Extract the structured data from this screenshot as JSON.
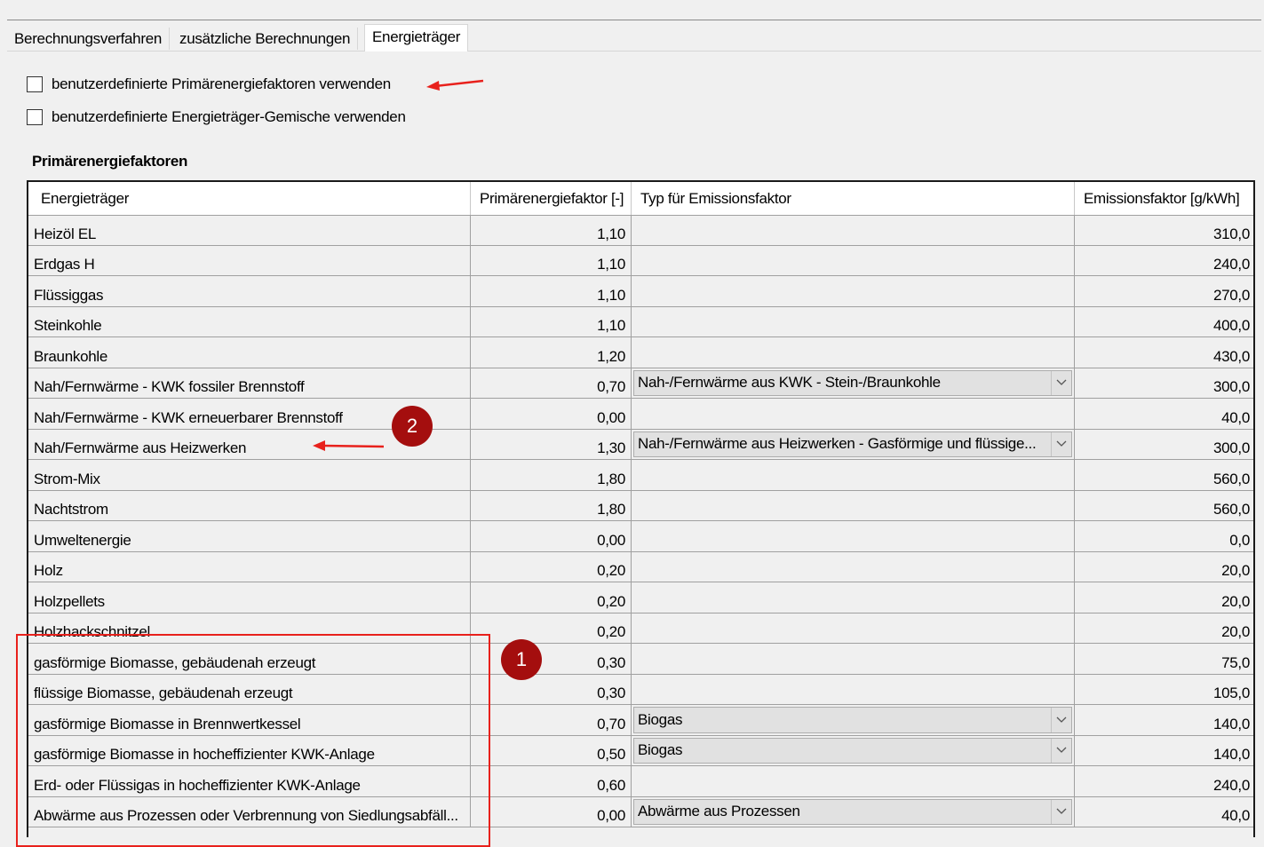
{
  "tabs": [
    {
      "label": "Berechnungsverfahren"
    },
    {
      "label": "zusätzliche Berechnungen"
    },
    {
      "label": "Energieträger"
    }
  ],
  "options": {
    "custom_pef": {
      "label": "benutzerdefinierte Primärenergiefaktoren verwenden",
      "checked": false
    },
    "custom_mix": {
      "label": "benutzerdefinierte Energieträger-Gemische verwenden",
      "checked": false
    }
  },
  "section_title": "Primärenergiefaktoren",
  "table": {
    "headers": {
      "carrier": "Energieträger",
      "pef": "Primärenergiefaktor [-]",
      "type": "Typ für Emissionsfaktor",
      "emission": "Emissionsfaktor [g/kWh]"
    },
    "rows": [
      {
        "carrier": "Heizöl EL",
        "pef": "1,10",
        "type": "",
        "emission": "310,0"
      },
      {
        "carrier": "Erdgas H",
        "pef": "1,10",
        "type": "",
        "emission": "240,0"
      },
      {
        "carrier": "Flüssiggas",
        "pef": "1,10",
        "type": "",
        "emission": "270,0"
      },
      {
        "carrier": "Steinkohle",
        "pef": "1,10",
        "type": "",
        "emission": "400,0"
      },
      {
        "carrier": "Braunkohle",
        "pef": "1,20",
        "type": "",
        "emission": "430,0"
      },
      {
        "carrier": "Nah/Fernwärme - KWK fossiler Brennstoff",
        "pef": "0,70",
        "type": "Nah-/Fernwärme aus KWK - Stein-/Braunkohle",
        "emission": "300,0"
      },
      {
        "carrier": "Nah/Fernwärme - KWK erneuerbarer Brennstoff",
        "pef": "0,00",
        "type": "",
        "emission": "40,0"
      },
      {
        "carrier": "Nah/Fernwärme aus Heizwerken",
        "pef": "1,30",
        "type": "Nah-/Fernwärme aus Heizwerken - Gasförmige und flüssige...",
        "emission": "300,0"
      },
      {
        "carrier": "Strom-Mix",
        "pef": "1,80",
        "type": "",
        "emission": "560,0"
      },
      {
        "carrier": "Nachtstrom",
        "pef": "1,80",
        "type": "",
        "emission": "560,0"
      },
      {
        "carrier": "Umweltenergie",
        "pef": "0,00",
        "type": "",
        "emission": "0,0"
      },
      {
        "carrier": "Holz",
        "pef": "0,20",
        "type": "",
        "emission": "20,0"
      },
      {
        "carrier": "Holzpellets",
        "pef": "0,20",
        "type": "",
        "emission": "20,0"
      },
      {
        "carrier": "Holzhackschnitzel",
        "pef": "0,20",
        "type": "",
        "emission": "20,0"
      },
      {
        "carrier": "gasförmige Biomasse, gebäudenah erzeugt",
        "pef": "0,30",
        "type": "",
        "emission": "75,0"
      },
      {
        "carrier": "flüssige Biomasse, gebäudenah erzeugt",
        "pef": "0,30",
        "type": "",
        "emission": "105,0"
      },
      {
        "carrier": "gasförmige Biomasse in Brennwertkessel",
        "pef": "0,70",
        "type": "Biogas",
        "emission": "140,0"
      },
      {
        "carrier": "gasförmige Biomasse in hocheffizienter KWK-Anlage",
        "pef": "0,50",
        "type": "Biogas",
        "emission": "140,0"
      },
      {
        "carrier": "Erd- oder Flüssigas in hocheffizienter KWK-Anlage",
        "pef": "0,60",
        "type": "",
        "emission": "240,0"
      },
      {
        "carrier": "Abwärme aus Prozessen oder Verbrennung von Siedlungsabfäll...",
        "pef": "0,00",
        "type": "Abwärme aus Prozessen",
        "emission": "40,0"
      }
    ]
  },
  "annotations": {
    "badge1": "1",
    "badge2": "2",
    "color": "#e8211c",
    "badge_color": "#a40e0e"
  }
}
